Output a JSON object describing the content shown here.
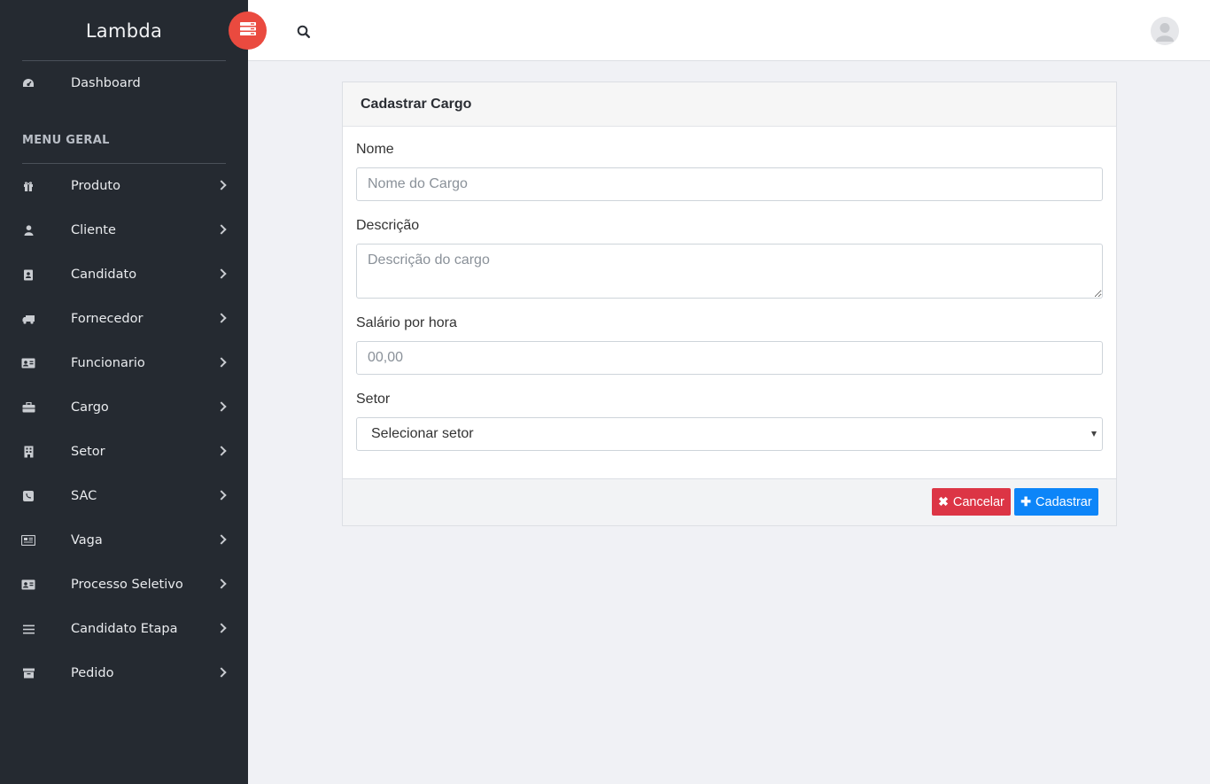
{
  "brand": {
    "name": "Lambda"
  },
  "sidebar": {
    "dashboard": "Dashboard",
    "menu_header": "MENU GERAL",
    "items": [
      {
        "label": "Produto",
        "icon": "gift-icon"
      },
      {
        "label": "Cliente",
        "icon": "user-icon"
      },
      {
        "label": "Candidato",
        "icon": "address-book-icon"
      },
      {
        "label": "Fornecedor",
        "icon": "truck-icon"
      },
      {
        "label": "Funcionario",
        "icon": "id-card-icon"
      },
      {
        "label": "Cargo",
        "icon": "briefcase-icon"
      },
      {
        "label": "Setor",
        "icon": "building-icon"
      },
      {
        "label": "SAC",
        "icon": "phone-icon"
      },
      {
        "label": "Vaga",
        "icon": "newspaper-icon"
      },
      {
        "label": "Processo Seletivo",
        "icon": "id-card-icon"
      },
      {
        "label": "Candidato Etapa",
        "icon": "bars-icon"
      },
      {
        "label": "Pedido",
        "icon": "archive-icon"
      }
    ]
  },
  "form": {
    "title": "Cadastrar Cargo",
    "nome_label": "Nome",
    "nome_placeholder": "Nome do Cargo",
    "descricao_label": "Descrição",
    "descricao_placeholder": "Descrição do cargo",
    "salario_label": "Salário por hora",
    "salario_placeholder": "00,00",
    "setor_label": "Setor",
    "setor_selected": "Selecionar setor",
    "cancel_label": "Cancelar",
    "save_label": "Cadastrar"
  },
  "colors": {
    "sidebar_bg": "#252a31",
    "toggle": "#ea4a3f",
    "cancel": "#dc3545",
    "primary": "#0d85f8"
  }
}
